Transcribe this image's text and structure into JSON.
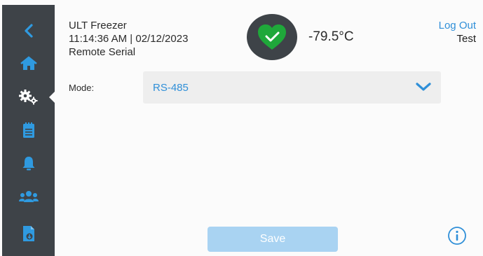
{
  "sidebar": {
    "items": [
      {
        "icon": "back-chevron-icon"
      },
      {
        "icon": "home-icon"
      },
      {
        "icon": "settings-gears-icon",
        "active": true
      },
      {
        "icon": "clipboard-icon"
      },
      {
        "icon": "bell-icon"
      },
      {
        "icon": "users-icon"
      },
      {
        "icon": "file-download-icon"
      }
    ]
  },
  "header": {
    "title": "ULT Freezer",
    "datetime": "11:14:36 AM | 02/12/2023",
    "subtitle": "Remote Serial",
    "temperature": "-79.5°C",
    "status_icon": "heart-check-icon",
    "logout_label": "Log Out",
    "user": "Test"
  },
  "mode": {
    "label": "Mode:",
    "value": "RS-485"
  },
  "save_label": "Save",
  "colors": {
    "sidebar": "#3e4348",
    "accent": "#2f8fd8",
    "status_ok": "#1fa83a",
    "save_disabled": "#a9d3f2"
  }
}
